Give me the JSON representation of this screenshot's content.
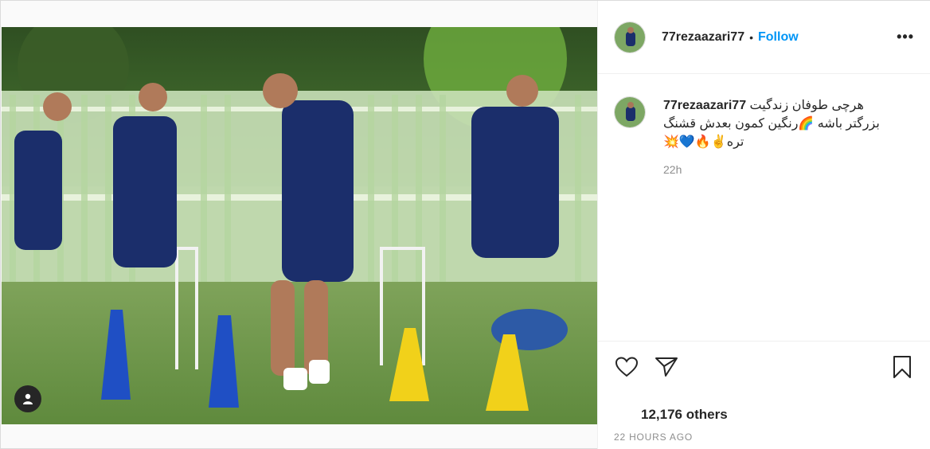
{
  "post": {
    "username": "77rezaazari77",
    "separator": "•",
    "follow_label": "Follow",
    "more_label": "•••",
    "caption_user": "77rezaazari77",
    "caption_line1": "هرچی طوفان زندگیت",
    "caption_line2": "بزرگتر باشه 🌈رنگین کمون بعدش قشنگ",
    "caption_line3": "تره✌🔥💙💥",
    "caption_time": "22h",
    "likes_text": "12,176 others",
    "posted_ago": "22 HOURS AGO"
  },
  "icons": {
    "like": "heart-icon",
    "share": "paper-plane-icon",
    "save": "bookmark-icon",
    "tagged": "user-tag-icon"
  },
  "colors": {
    "follow": "#0095f6",
    "jersey": "#1b2e6b",
    "grass": "#6c8f4a"
  }
}
